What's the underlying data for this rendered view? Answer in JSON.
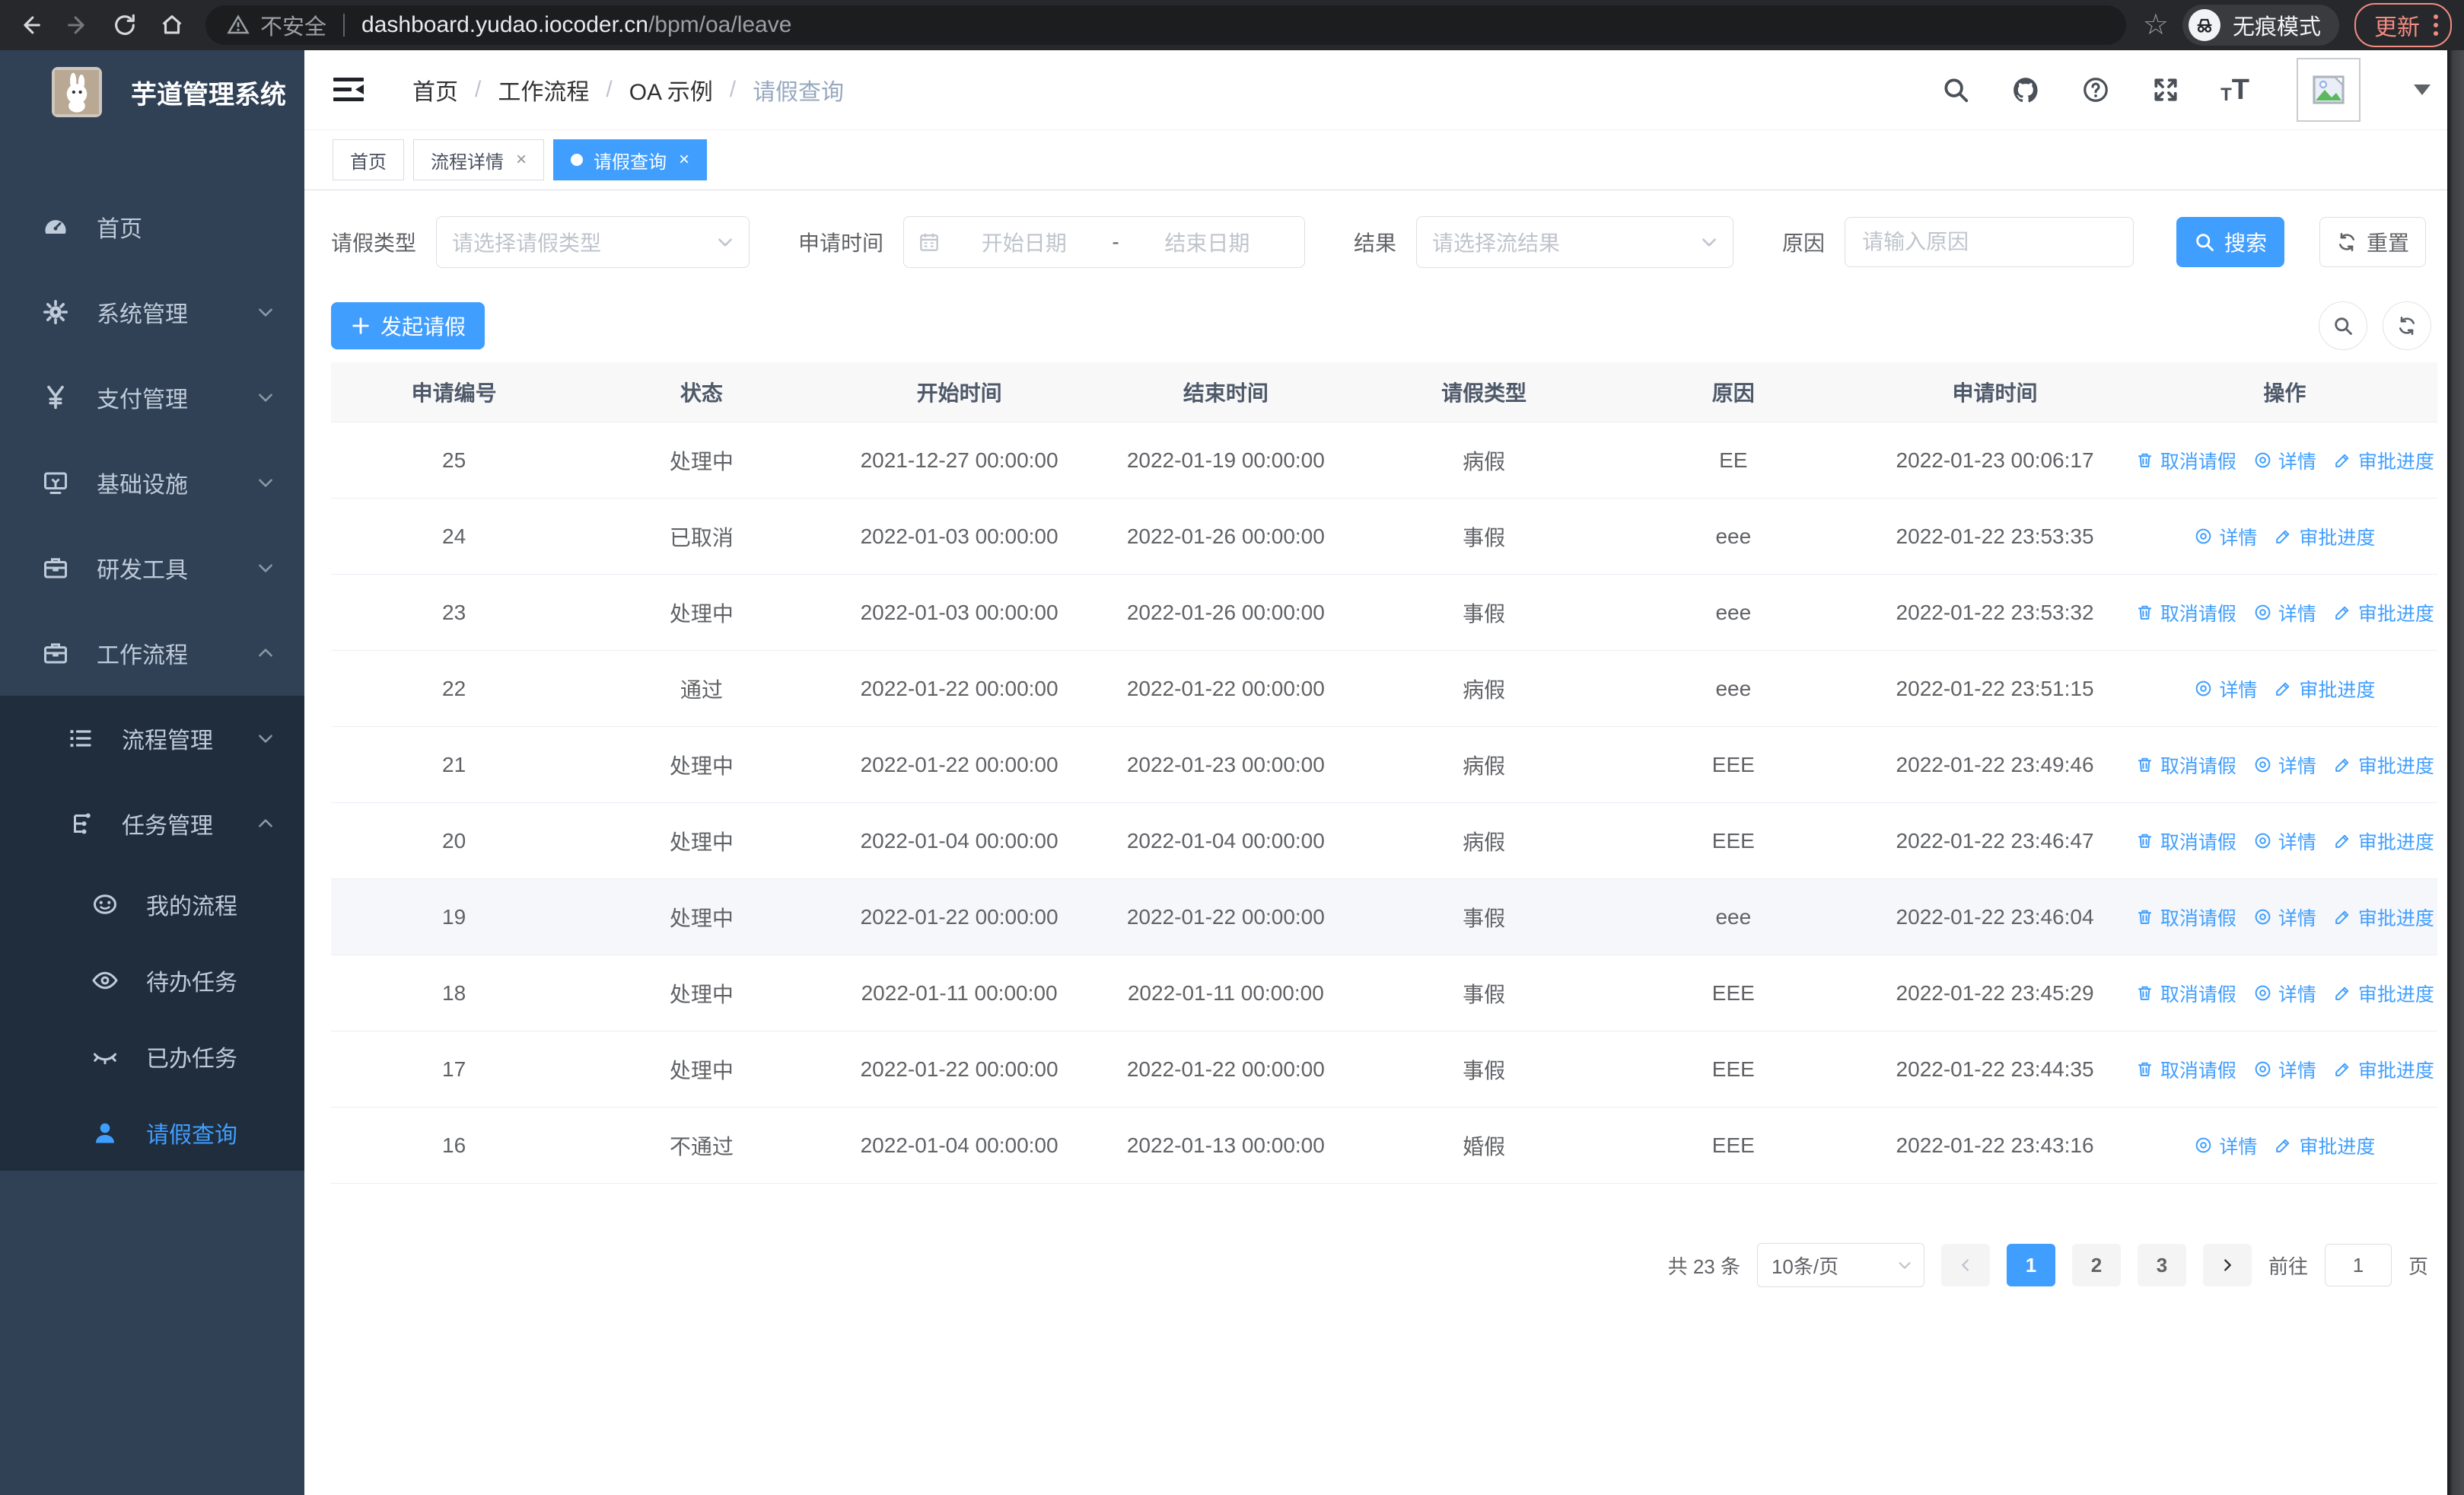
{
  "colors": {
    "accent": "#409eff",
    "sidebar_bg": "#304156",
    "sidebar_submenu_bg": "#1f2d3d",
    "browser_update_accent": "#f28b82",
    "table_header_bg": "#f8f8f9"
  },
  "browser": {
    "security_text": "不安全",
    "url_host": "dashboard.yudao.iocoder.cn",
    "url_path": "/bpm/oa/leave",
    "incognito_label": "无痕模式",
    "update_label": "更新"
  },
  "sidebar": {
    "title": "芋道管理系统",
    "items": [
      {
        "key": "home",
        "label": "首页",
        "icon": "gauge",
        "level": 1,
        "chevron": "",
        "sub": false,
        "active": false
      },
      {
        "key": "system",
        "label": "系统管理",
        "icon": "gear",
        "level": 1,
        "chevron": "down",
        "sub": false,
        "active": false
      },
      {
        "key": "payment",
        "label": "支付管理",
        "icon": "yen",
        "level": 1,
        "chevron": "down",
        "sub": false,
        "active": false
      },
      {
        "key": "infra",
        "label": "基础设施",
        "icon": "monitor",
        "level": 1,
        "chevron": "down",
        "sub": false,
        "active": false
      },
      {
        "key": "devtools",
        "label": "研发工具",
        "icon": "briefcase",
        "level": 1,
        "chevron": "down",
        "sub": false,
        "active": false
      },
      {
        "key": "workflow",
        "label": "工作流程",
        "icon": "briefcase",
        "level": 1,
        "chevron": "up",
        "sub": false,
        "active": false
      },
      {
        "key": "process-mgmt",
        "label": "流程管理",
        "icon": "flowlist",
        "level": 2,
        "chevron": "down",
        "sub": true,
        "active": false
      },
      {
        "key": "task-mgmt",
        "label": "任务管理",
        "icon": "tasktree",
        "level": 2,
        "chevron": "up",
        "sub": true,
        "active": false
      },
      {
        "key": "my-process",
        "label": "我的流程",
        "icon": "robot",
        "level": 3,
        "chevron": "",
        "sub": true,
        "active": false
      },
      {
        "key": "todo-task",
        "label": "待办任务",
        "icon": "eye",
        "level": 3,
        "chevron": "",
        "sub": true,
        "active": false
      },
      {
        "key": "done-task",
        "label": "已办任务",
        "icon": "eyeclosed",
        "level": 3,
        "chevron": "",
        "sub": true,
        "active": false
      },
      {
        "key": "leave-query",
        "label": "请假查询",
        "icon": "user",
        "level": 3,
        "chevron": "",
        "sub": true,
        "active": true
      }
    ]
  },
  "header": {
    "breadcrumb": [
      "首页",
      "工作流程",
      "OA 示例",
      "请假查询"
    ]
  },
  "tabs": [
    {
      "key": "home",
      "label": "首页",
      "closable": false,
      "active": false
    },
    {
      "key": "process-detail",
      "label": "流程详情",
      "closable": true,
      "active": false
    },
    {
      "key": "leave-query",
      "label": "请假查询",
      "closable": true,
      "active": true
    }
  ],
  "filters": {
    "leave_type": {
      "label": "请假类型",
      "placeholder": "请选择请假类型"
    },
    "apply_time": {
      "label": "申请时间",
      "start_placeholder": "开始日期",
      "separator": "-",
      "end_placeholder": "结束日期"
    },
    "result": {
      "label": "结果",
      "placeholder": "请选择流结果"
    },
    "reason": {
      "label": "原因",
      "placeholder": "请输入原因"
    },
    "search_label": "搜索",
    "reset_label": "重置"
  },
  "toolbar": {
    "create_label": "发起请假"
  },
  "table": {
    "columns": [
      "申请编号",
      "状态",
      "开始时间",
      "结束时间",
      "请假类型",
      "原因",
      "申请时间",
      "操作"
    ],
    "action_labels": {
      "cancel": "取消请假",
      "detail": "详情",
      "progress": "审批进度"
    },
    "rows": [
      {
        "id": "25",
        "status": "处理中",
        "start": "2021-12-27 00:00:00",
        "end": "2022-01-19 00:00:00",
        "type": "病假",
        "reason": "EE",
        "apply": "2022-01-23 00:06:17",
        "actions": [
          "cancel",
          "detail",
          "progress"
        ],
        "hover": false
      },
      {
        "id": "24",
        "status": "已取消",
        "start": "2022-01-03 00:00:00",
        "end": "2022-01-26 00:00:00",
        "type": "事假",
        "reason": "eee",
        "apply": "2022-01-22 23:53:35",
        "actions": [
          "detail",
          "progress"
        ],
        "hover": false
      },
      {
        "id": "23",
        "status": "处理中",
        "start": "2022-01-03 00:00:00",
        "end": "2022-01-26 00:00:00",
        "type": "事假",
        "reason": "eee",
        "apply": "2022-01-22 23:53:32",
        "actions": [
          "cancel",
          "detail",
          "progress"
        ],
        "hover": false
      },
      {
        "id": "22",
        "status": "通过",
        "start": "2022-01-22 00:00:00",
        "end": "2022-01-22 00:00:00",
        "type": "病假",
        "reason": "eee",
        "apply": "2022-01-22 23:51:15",
        "actions": [
          "detail",
          "progress"
        ],
        "hover": false
      },
      {
        "id": "21",
        "status": "处理中",
        "start": "2022-01-22 00:00:00",
        "end": "2022-01-23 00:00:00",
        "type": "病假",
        "reason": "EEE",
        "apply": "2022-01-22 23:49:46",
        "actions": [
          "cancel",
          "detail",
          "progress"
        ],
        "hover": false
      },
      {
        "id": "20",
        "status": "处理中",
        "start": "2022-01-04 00:00:00",
        "end": "2022-01-04 00:00:00",
        "type": "病假",
        "reason": "EEE",
        "apply": "2022-01-22 23:46:47",
        "actions": [
          "cancel",
          "detail",
          "progress"
        ],
        "hover": false
      },
      {
        "id": "19",
        "status": "处理中",
        "start": "2022-01-22 00:00:00",
        "end": "2022-01-22 00:00:00",
        "type": "事假",
        "reason": "eee",
        "apply": "2022-01-22 23:46:04",
        "actions": [
          "cancel",
          "detail",
          "progress"
        ],
        "hover": true
      },
      {
        "id": "18",
        "status": "处理中",
        "start": "2022-01-11 00:00:00",
        "end": "2022-01-11 00:00:00",
        "type": "事假",
        "reason": "EEE",
        "apply": "2022-01-22 23:45:29",
        "actions": [
          "cancel",
          "detail",
          "progress"
        ],
        "hover": false
      },
      {
        "id": "17",
        "status": "处理中",
        "start": "2022-01-22 00:00:00",
        "end": "2022-01-22 00:00:00",
        "type": "事假",
        "reason": "EEE",
        "apply": "2022-01-22 23:44:35",
        "actions": [
          "cancel",
          "detail",
          "progress"
        ],
        "hover": false
      },
      {
        "id": "16",
        "status": "不通过",
        "start": "2022-01-04 00:00:00",
        "end": "2022-01-13 00:00:00",
        "type": "婚假",
        "reason": "EEE",
        "apply": "2022-01-22 23:43:16",
        "actions": [
          "detail",
          "progress"
        ],
        "hover": false
      }
    ]
  },
  "pagination": {
    "total_text": "共 23 条",
    "page_size_text": "10条/页",
    "pages": [
      "1",
      "2",
      "3"
    ],
    "current_page": "1",
    "goto_label": "前往",
    "goto_value": "1",
    "page_unit": "页"
  }
}
